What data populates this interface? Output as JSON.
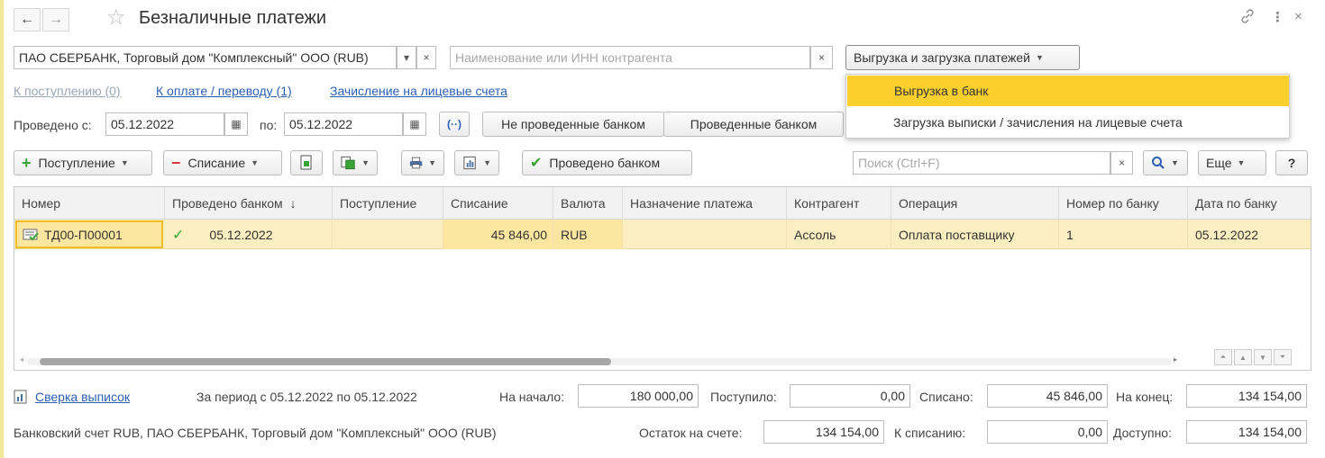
{
  "window": {
    "title": "Безналичные платежи",
    "back_icon": "←",
    "forward_icon": "→",
    "star_icon": "☆",
    "link_icon": "🔗",
    "more_icon": "⋮",
    "close_icon": "×"
  },
  "filters": {
    "bank_account": "ПАО СБЕРБАНК, Торговый дом \"Комплексный\" ООО (RUB)",
    "counterparty_placeholder": "Наименование или ИНН контрагента",
    "exchange_button": "Выгрузка и загрузка платежей"
  },
  "menu": {
    "items": [
      "Выгрузка в банк",
      "Загрузка выписки / зачисления на лицевые счета"
    ]
  },
  "links": {
    "incoming": "К поступлению (0)",
    "to_pay": "К оплате / переводу (1)",
    "accounts": "Зачисление на лицевые счета"
  },
  "period": {
    "from_label": "Проведено с:",
    "from_value": "05.12.2022",
    "to_label": "по:",
    "to_value": "05.12.2022",
    "not_posted": "Не проведенные банком",
    "posted": "Проведенные банком"
  },
  "toolbar": {
    "income": "Поступление",
    "writeoff": "Списание",
    "posted_bank": "Проведено банком",
    "search_placeholder": "Поиск (Ctrl+F)",
    "more": "Еще",
    "help": "?"
  },
  "table": {
    "columns": [
      "Номер",
      "Проведено банком",
      "Поступление",
      "Списание",
      "Валюта",
      "Назначение платежа",
      "Контрагент",
      "Операция",
      "Номер по банку",
      "Дата по банку"
    ],
    "rows": [
      {
        "number": "ТД00-П00001",
        "posted": "05.12.2022",
        "income": "",
        "writeoff": "45 846,00",
        "currency": "RUB",
        "purpose": "",
        "counterparty": "Ассоль",
        "operation": "Оплата поставщику",
        "bank_number": "1",
        "bank_date": "05.12.2022"
      }
    ]
  },
  "footer": {
    "reconcile": "Сверка выписок",
    "period_text": "За период с 05.12.2022 по 05.12.2022",
    "start_label": "На начало:",
    "start_value": "180 000,00",
    "received_label": "Поступило:",
    "received_value": "0,00",
    "spent_label": "Списано:",
    "spent_value": "45 846,00",
    "end_label": "На конец:",
    "end_value": "134 154,00",
    "account_text": "Банковский счет RUB, ПАО СБЕРБАНК, Торговый дом \"Комплексный\" ООО (RUB)",
    "balance_label": "Остаток на счете:",
    "balance_value": "134 154,00",
    "to_write_label": "К списанию:",
    "to_write_value": "0,00",
    "available_label": "Доступно:",
    "available_value": "134 154,00"
  },
  "colors": {
    "accent": "#fbcf2c",
    "link": "#2b5fb4",
    "row_selected": "#fbeec0",
    "plus_green": "#3aa335",
    "minus_red": "#d9363e"
  }
}
